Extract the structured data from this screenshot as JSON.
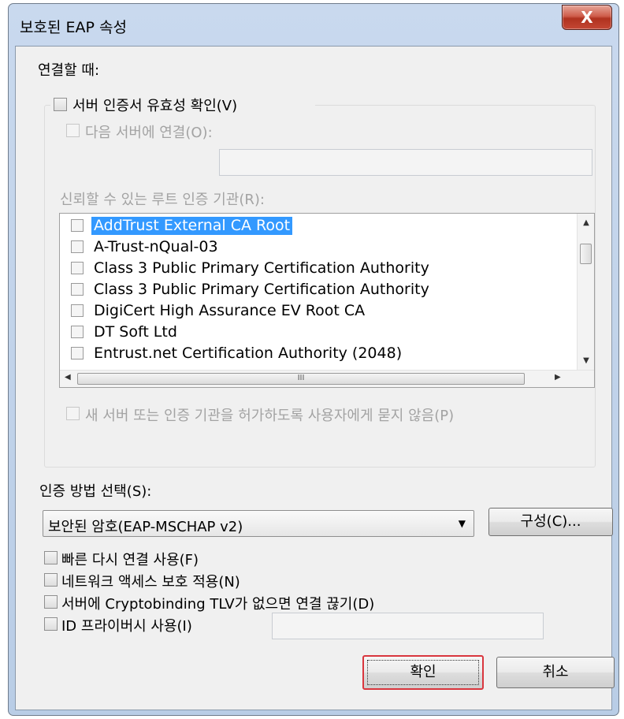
{
  "window": {
    "title": "보호된 EAP 속성",
    "close_glyph": "X"
  },
  "connect": {
    "heading": "연결할 때:",
    "verify_cert_label": "서버 인증서 유효성 확인(V)",
    "connect_servers_label": "다음 서버에 연결(O):",
    "servers_value": "",
    "trusted_ca_label": "신뢰할 수 있는 루트 인증 기관(R):",
    "ca_list": [
      {
        "name": "AddTrust External CA Root",
        "checked": false,
        "selected": true
      },
      {
        "name": "A-Trust-nQual-03",
        "checked": false,
        "selected": false
      },
      {
        "name": "Class 3 Public Primary Certification Authority",
        "checked": false,
        "selected": false
      },
      {
        "name": "Class 3 Public Primary Certification Authority",
        "checked": false,
        "selected": false
      },
      {
        "name": "DigiCert High Assurance EV Root CA",
        "checked": false,
        "selected": false
      },
      {
        "name": "DT Soft Ltd",
        "checked": false,
        "selected": false
      },
      {
        "name": "Entrust.net Certification Authority (2048)",
        "checked": false,
        "selected": false
      }
    ],
    "hscroll_grip": "III",
    "no_prompt_label": "새 서버 또는 인증 기관을 허가하도록 사용자에게 묻지 않음(P)"
  },
  "auth": {
    "heading": "인증 방법 선택(S):",
    "method_value": "보안된 암호(EAP-MSCHAP v2)",
    "configure_label": "구성(C)...",
    "options": [
      "빠른 다시 연결 사용(F)",
      "네트워크 액세스 보호 적용(N)",
      "서버에 Cryptobinding TLV가 없으면 연결 끊기(D)",
      "ID 프라이버시 사용(I)"
    ],
    "identity_value": ""
  },
  "buttons": {
    "ok": "확인",
    "cancel": "취소"
  },
  "colors": {
    "selection": "#3399ff",
    "default_button_border": "#d9363e",
    "close_button": "#c44734"
  }
}
